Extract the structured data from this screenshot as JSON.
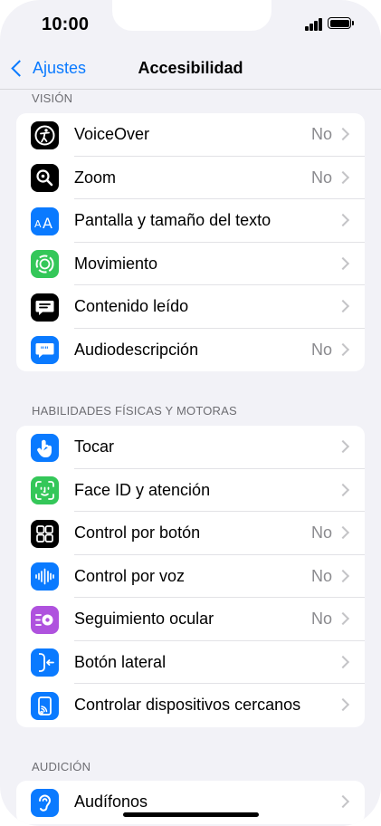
{
  "status_bar": {
    "time": "10:00"
  },
  "nav": {
    "back_label": "Ajustes",
    "title": "Accesibilidad"
  },
  "colors": {
    "accent": "#0a7aff",
    "background": "#f2f2f7"
  },
  "sections": [
    {
      "label": "VISIÓN",
      "items": [
        {
          "label": "VoiceOver",
          "value": "No",
          "icon": "voiceover-icon"
        },
        {
          "label": "Zoom",
          "value": "No",
          "icon": "zoom-icon"
        },
        {
          "label": "Pantalla y tamaño del texto",
          "value": "",
          "icon": "text-size-icon"
        },
        {
          "label": "Movimiento",
          "value": "",
          "icon": "motion-icon"
        },
        {
          "label": "Contenido leído",
          "value": "",
          "icon": "spoken-content-icon"
        },
        {
          "label": "Audiodescripción",
          "value": "No",
          "icon": "audio-description-icon"
        }
      ]
    },
    {
      "label": "HABILIDADES FÍSICAS Y MOTORAS",
      "items": [
        {
          "label": "Tocar",
          "value": "",
          "icon": "touch-icon"
        },
        {
          "label": "Face ID y atención",
          "value": "",
          "icon": "face-id-icon"
        },
        {
          "label": "Control por botón",
          "value": "No",
          "icon": "switch-control-icon"
        },
        {
          "label": "Control por voz",
          "value": "No",
          "icon": "voice-control-icon"
        },
        {
          "label": "Seguimiento ocular",
          "value": "No",
          "icon": "eye-tracking-icon"
        },
        {
          "label": "Botón lateral",
          "value": "",
          "icon": "side-button-icon"
        },
        {
          "label": "Controlar dispositivos cercanos",
          "value": "",
          "icon": "nearby-devices-icon"
        }
      ]
    },
    {
      "label": "AUDICIÓN",
      "items": [
        {
          "label": "Audífonos",
          "value": "",
          "icon": "hearing-devices-icon"
        }
      ]
    }
  ]
}
